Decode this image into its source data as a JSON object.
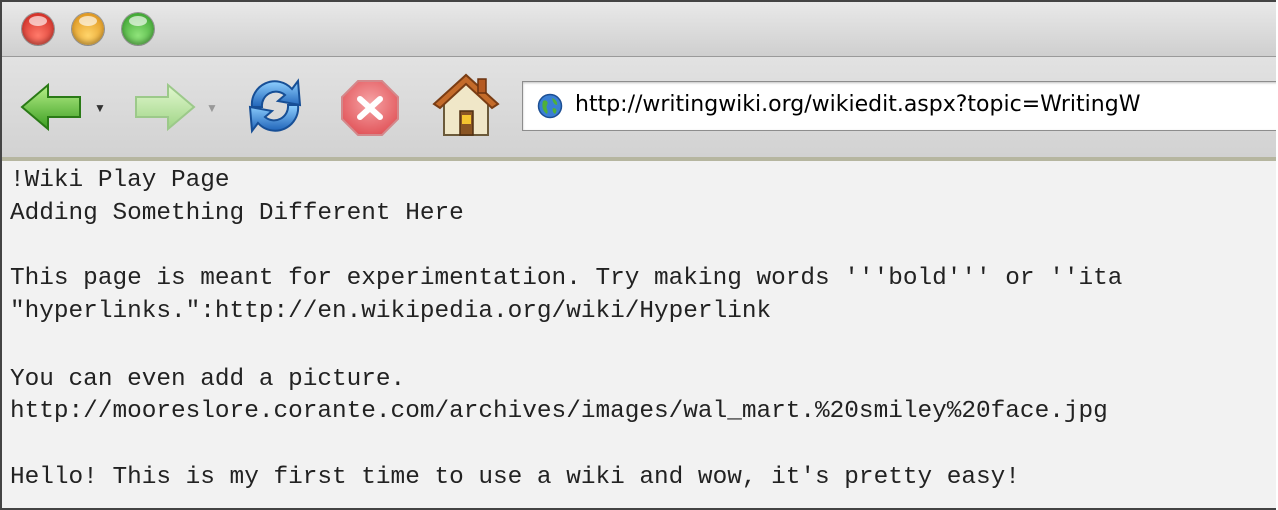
{
  "window": {
    "controls": [
      "close",
      "minimize",
      "zoom"
    ]
  },
  "toolbar": {
    "back_icon": "green-left-arrow-icon",
    "forward_icon": "green-right-arrow-icon",
    "reload_icon": "reload-icon",
    "stop_icon": "stop-icon",
    "home_icon": "home-icon",
    "url": "http://writingwiki.org/wikiedit.aspx?topic=WritingW"
  },
  "editor": {
    "lines": [
      "!Wiki Play Page",
      "Adding Something Different Here",
      "",
      "This page is meant for experimentation. Try making words '''bold''' or ''ita",
      "\"hyperlinks.\":http://en.wikipedia.org/wiki/Hyperlink",
      "",
      "You can even add a picture.",
      "http://mooreslore.corante.com/archives/images/wal_mart.%20smiley%20face.jpg",
      "",
      "Hello! This is my first time to use a wiki and wow, it's pretty easy!"
    ]
  },
  "colors": {
    "accent_green": "#3fae2a",
    "reload_blue": "#2c7fd0",
    "stop_red": "#e0575a",
    "content_bg": "#f2f2f2"
  }
}
